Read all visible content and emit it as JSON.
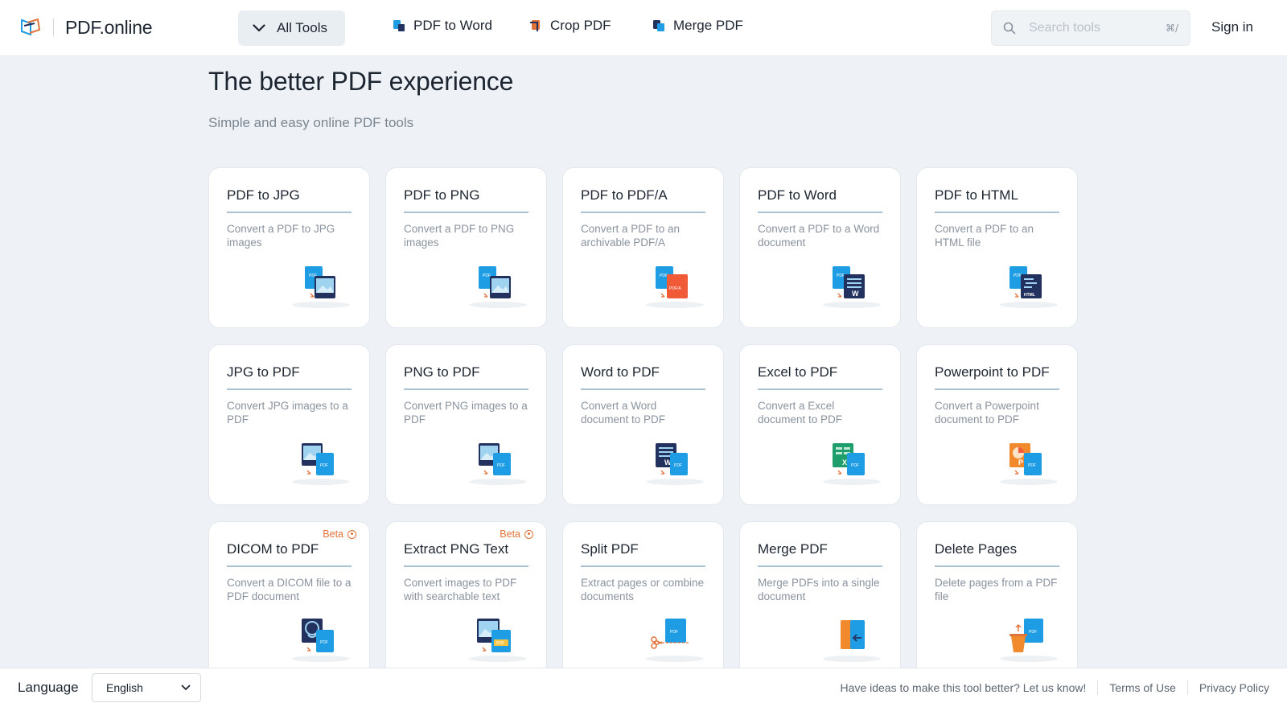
{
  "header": {
    "logo_text": "PDF.online",
    "all_tools_label": "All Tools",
    "nav": [
      {
        "label": "PDF to Word",
        "icon": "pdf-to-word-icon"
      },
      {
        "label": "Crop PDF",
        "icon": "crop-pdf-icon"
      },
      {
        "label": "Merge PDF",
        "icon": "merge-pdf-icon"
      }
    ],
    "search_placeholder": "Search tools",
    "search_shortcut": "⌘/",
    "sign_in_label": "Sign in"
  },
  "hero": {
    "title": "The better PDF experience",
    "subtitle": "Simple and easy online PDF tools"
  },
  "tools": [
    {
      "title": "PDF to JPG",
      "desc": "Convert a PDF to JPG images",
      "icon": "pdf-to-image-icon"
    },
    {
      "title": "PDF to PNG",
      "desc": "Convert a PDF to PNG images",
      "icon": "pdf-to-image-icon"
    },
    {
      "title": "PDF to PDF/A",
      "desc": "Convert a PDF to an archivable PDF/A",
      "icon": "pdf-to-pdfa-icon"
    },
    {
      "title": "PDF to Word",
      "desc": "Convert a PDF to a Word document",
      "icon": "pdf-to-word-icon"
    },
    {
      "title": "PDF to HTML",
      "desc": "Convert a PDF to an HTML file",
      "icon": "pdf-to-html-icon"
    },
    {
      "title": "JPG to PDF",
      "desc": "Convert JPG images to a PDF",
      "icon": "image-to-pdf-icon"
    },
    {
      "title": "PNG to PDF",
      "desc": "Convert PNG images to a PDF",
      "icon": "image-to-pdf-icon"
    },
    {
      "title": "Word to PDF",
      "desc": "Convert a Word document to PDF",
      "icon": "word-to-pdf-icon"
    },
    {
      "title": "Excel to PDF",
      "desc": "Convert a Excel document to PDF",
      "icon": "excel-to-pdf-icon"
    },
    {
      "title": "Powerpoint to PDF",
      "desc": "Convert a Powerpoint document to PDF",
      "icon": "powerpoint-to-pdf-icon"
    },
    {
      "title": "DICOM to PDF",
      "desc": "Convert a DICOM file to a PDF document",
      "icon": "dicom-to-pdf-icon",
      "badge": "Beta"
    },
    {
      "title": "Extract PNG Text",
      "desc": "Convert images to PDF with searchable text",
      "icon": "extract-text-icon",
      "badge": "Beta"
    },
    {
      "title": "Split PDF",
      "desc": "Extract pages or combine documents",
      "icon": "split-pdf-icon"
    },
    {
      "title": "Merge PDF",
      "desc": "Merge PDFs into a single document",
      "icon": "merge-pdf-icon"
    },
    {
      "title": "Delete Pages",
      "desc": "Delete pages from a PDF file",
      "icon": "delete-pages-icon"
    }
  ],
  "footer": {
    "language_label": "Language",
    "language_value": "English",
    "links": [
      "Have ideas to make this tool better? Let us know!",
      "Terms of Use",
      "Privacy Policy"
    ]
  },
  "colors": {
    "accent_blue": "#1e9de4",
    "dark_navy": "#23315e",
    "orange": "#e0733a",
    "background": "#eef2f6"
  }
}
